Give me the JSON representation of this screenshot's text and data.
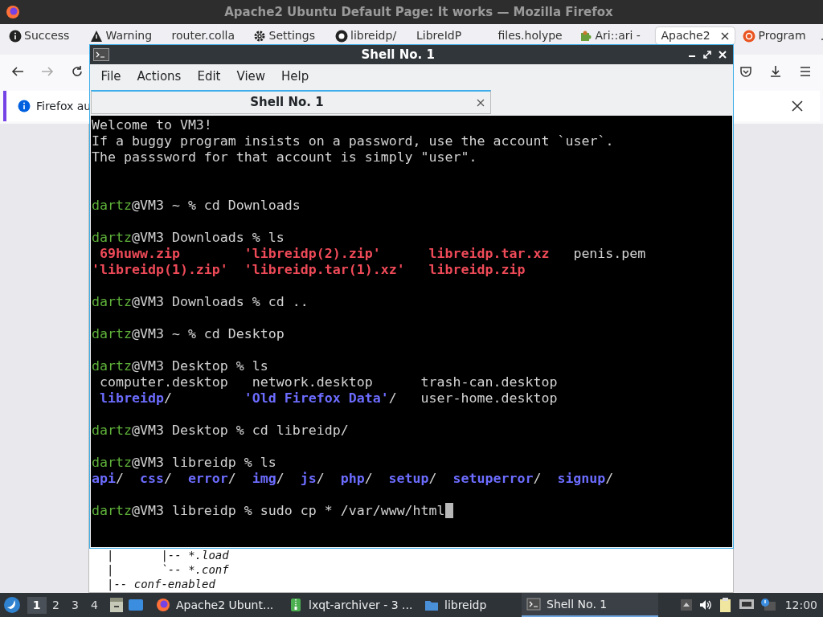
{
  "browser": {
    "title": "Apache2 Ubuntu Default Page: It works — Mozilla Firefox",
    "tabs": [
      {
        "label": "Success",
        "selected": false,
        "kind": "info"
      },
      {
        "label": "Warning",
        "selected": false,
        "kind": "warning"
      },
      {
        "label": "router.colla",
        "selected": false,
        "kind": "plain"
      },
      {
        "label": "Settings",
        "selected": false,
        "kind": "gear"
      },
      {
        "label": "libreidp/",
        "selected": false,
        "kind": "octocat"
      },
      {
        "label": "LibreIdP",
        "selected": false,
        "kind": "plain"
      },
      {
        "label": "files.holype",
        "selected": false,
        "kind": "plain"
      },
      {
        "label": "Ari::ari -",
        "selected": false,
        "kind": "puzzle"
      },
      {
        "label": "Apache2",
        "selected": true,
        "kind": "plain"
      },
      {
        "label": "Program",
        "selected": false,
        "kind": "ubuntu"
      }
    ],
    "notification": {
      "text": "Firefox au"
    },
    "page_lines": [
      "|       |-- *.load",
      "|       `-- *.conf",
      "|-- conf-enabled"
    ]
  },
  "terminal_window": {
    "title": "Shell No. 1",
    "menu": [
      "File",
      "Actions",
      "Edit",
      "View",
      "Help"
    ],
    "tabs": [
      {
        "label": "Shell No. 1",
        "selected": true
      }
    ],
    "blocks": [
      {
        "kind": "text",
        "lines": [
          "Welcome to VM3!",
          "If a buggy program insists on a password, use the account `user`.",
          "The passsword for that account is simply \"user\"."
        ]
      },
      {
        "kind": "command",
        "user": "dartz",
        "rest": "@VM3 ~ % cd Downloads"
      },
      {
        "kind": "command",
        "user": "dartz",
        "rest": "@VM3 Downloads % ls"
      },
      {
        "kind": "listing",
        "rows": [
          [
            {
              "name": "69huww.zip",
              "kind": "file"
            },
            {
              "name": "'libreidp(2).zip'",
              "kind": "file"
            },
            {
              "name": "libreidp.tar.xz",
              "kind": "file"
            },
            {
              "name": "penis.pem",
              "kind": "plain"
            }
          ],
          [
            {
              "name": "'libreidp(1).zip'",
              "kind": "file"
            },
            {
              "name": "'libreidp.tar(1).xz'",
              "kind": "file"
            },
            {
              "name": "libreidp.zip",
              "kind": "file"
            }
          ]
        ]
      },
      {
        "kind": "command",
        "user": "dartz",
        "rest": "@VM3 Downloads % cd .."
      },
      {
        "kind": "command",
        "user": "dartz",
        "rest": "@VM3 ~ % cd Desktop"
      },
      {
        "kind": "command",
        "user": "dartz",
        "rest": "@VM3 Desktop % ls"
      },
      {
        "kind": "listing",
        "rows": [
          [
            {
              "name": "computer.desktop",
              "kind": "plain"
            },
            {
              "name": "network.desktop",
              "kind": "plain"
            },
            {
              "name": "trash-can.desktop",
              "kind": "plain"
            }
          ],
          [
            {
              "name": "libreidp",
              "kind": "dir",
              "suffix": "/"
            },
            {
              "name": "'Old Firefox Data'",
              "kind": "dir",
              "suffix": "/"
            },
            {
              "name": "user-home.desktop",
              "kind": "plain"
            }
          ]
        ]
      },
      {
        "kind": "command",
        "user": "dartz",
        "rest": "@VM3 Desktop % cd libreidp/"
      },
      {
        "kind": "command",
        "user": "dartz",
        "rest": "@VM3 libreidp % ls"
      },
      {
        "kind": "listing",
        "rows": [
          [
            {
              "name": "api",
              "kind": "dir",
              "suffix": "/"
            },
            {
              "name": "css",
              "kind": "dir",
              "suffix": "/"
            },
            {
              "name": "error",
              "kind": "dir",
              "suffix": "/"
            },
            {
              "name": "img",
              "kind": "dir",
              "suffix": "/"
            },
            {
              "name": "js",
              "kind": "dir",
              "suffix": "/"
            },
            {
              "name": "php",
              "kind": "dir",
              "suffix": "/"
            },
            {
              "name": "setup",
              "kind": "dir",
              "suffix": "/"
            },
            {
              "name": "setuperror",
              "kind": "dir",
              "suffix": "/"
            },
            {
              "name": "signup",
              "kind": "dir",
              "suffix": "/"
            }
          ]
        ]
      },
      {
        "kind": "command",
        "user": "dartz",
        "rest": "@VM3 libreidp % sudo cp * /var/www/html"
      }
    ],
    "cursor_visible": true
  },
  "taskbar": {
    "desktops": [
      {
        "label": "1",
        "selected": true
      },
      {
        "label": "2",
        "selected": false
      },
      {
        "label": "3",
        "selected": false
      },
      {
        "label": "4",
        "selected": false
      }
    ],
    "tasks": [
      {
        "label": "Apache2 Ubunt...",
        "selected": false,
        "kind": "firefox"
      },
      {
        "label": "lxqt-archiver - 3 ...",
        "selected": false,
        "kind": "archive"
      },
      {
        "label": "libreidp",
        "selected": false,
        "kind": "folder"
      },
      {
        "label": "Shell No. 1",
        "selected": true,
        "kind": "terminal"
      }
    ],
    "clock": "12:00"
  }
}
